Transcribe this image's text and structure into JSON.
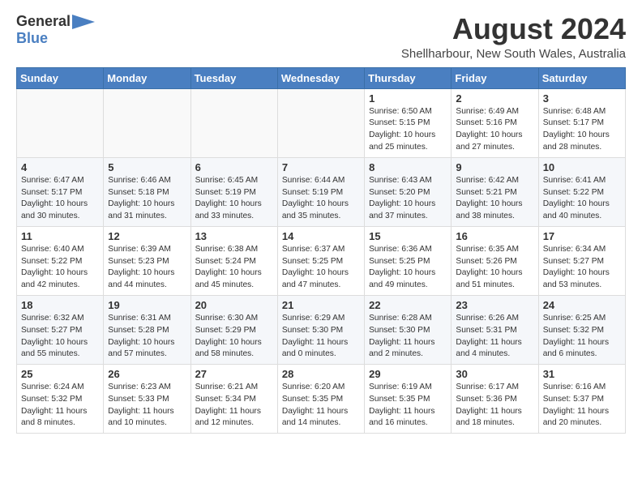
{
  "logo": {
    "general": "General",
    "blue": "Blue"
  },
  "title": {
    "month_year": "August 2024",
    "location": "Shellharbour, New South Wales, Australia"
  },
  "weekdays": [
    "Sunday",
    "Monday",
    "Tuesday",
    "Wednesday",
    "Thursday",
    "Friday",
    "Saturday"
  ],
  "weeks": [
    [
      {
        "day": "",
        "detail": ""
      },
      {
        "day": "",
        "detail": ""
      },
      {
        "day": "",
        "detail": ""
      },
      {
        "day": "",
        "detail": ""
      },
      {
        "day": "1",
        "detail": "Sunrise: 6:50 AM\nSunset: 5:15 PM\nDaylight: 10 hours\nand 25 minutes."
      },
      {
        "day": "2",
        "detail": "Sunrise: 6:49 AM\nSunset: 5:16 PM\nDaylight: 10 hours\nand 27 minutes."
      },
      {
        "day": "3",
        "detail": "Sunrise: 6:48 AM\nSunset: 5:17 PM\nDaylight: 10 hours\nand 28 minutes."
      }
    ],
    [
      {
        "day": "4",
        "detail": "Sunrise: 6:47 AM\nSunset: 5:17 PM\nDaylight: 10 hours\nand 30 minutes."
      },
      {
        "day": "5",
        "detail": "Sunrise: 6:46 AM\nSunset: 5:18 PM\nDaylight: 10 hours\nand 31 minutes."
      },
      {
        "day": "6",
        "detail": "Sunrise: 6:45 AM\nSunset: 5:19 PM\nDaylight: 10 hours\nand 33 minutes."
      },
      {
        "day": "7",
        "detail": "Sunrise: 6:44 AM\nSunset: 5:19 PM\nDaylight: 10 hours\nand 35 minutes."
      },
      {
        "day": "8",
        "detail": "Sunrise: 6:43 AM\nSunset: 5:20 PM\nDaylight: 10 hours\nand 37 minutes."
      },
      {
        "day": "9",
        "detail": "Sunrise: 6:42 AM\nSunset: 5:21 PM\nDaylight: 10 hours\nand 38 minutes."
      },
      {
        "day": "10",
        "detail": "Sunrise: 6:41 AM\nSunset: 5:22 PM\nDaylight: 10 hours\nand 40 minutes."
      }
    ],
    [
      {
        "day": "11",
        "detail": "Sunrise: 6:40 AM\nSunset: 5:22 PM\nDaylight: 10 hours\nand 42 minutes."
      },
      {
        "day": "12",
        "detail": "Sunrise: 6:39 AM\nSunset: 5:23 PM\nDaylight: 10 hours\nand 44 minutes."
      },
      {
        "day": "13",
        "detail": "Sunrise: 6:38 AM\nSunset: 5:24 PM\nDaylight: 10 hours\nand 45 minutes."
      },
      {
        "day": "14",
        "detail": "Sunrise: 6:37 AM\nSunset: 5:25 PM\nDaylight: 10 hours\nand 47 minutes."
      },
      {
        "day": "15",
        "detail": "Sunrise: 6:36 AM\nSunset: 5:25 PM\nDaylight: 10 hours\nand 49 minutes."
      },
      {
        "day": "16",
        "detail": "Sunrise: 6:35 AM\nSunset: 5:26 PM\nDaylight: 10 hours\nand 51 minutes."
      },
      {
        "day": "17",
        "detail": "Sunrise: 6:34 AM\nSunset: 5:27 PM\nDaylight: 10 hours\nand 53 minutes."
      }
    ],
    [
      {
        "day": "18",
        "detail": "Sunrise: 6:32 AM\nSunset: 5:27 PM\nDaylight: 10 hours\nand 55 minutes."
      },
      {
        "day": "19",
        "detail": "Sunrise: 6:31 AM\nSunset: 5:28 PM\nDaylight: 10 hours\nand 57 minutes."
      },
      {
        "day": "20",
        "detail": "Sunrise: 6:30 AM\nSunset: 5:29 PM\nDaylight: 10 hours\nand 58 minutes."
      },
      {
        "day": "21",
        "detail": "Sunrise: 6:29 AM\nSunset: 5:30 PM\nDaylight: 11 hours\nand 0 minutes."
      },
      {
        "day": "22",
        "detail": "Sunrise: 6:28 AM\nSunset: 5:30 PM\nDaylight: 11 hours\nand 2 minutes."
      },
      {
        "day": "23",
        "detail": "Sunrise: 6:26 AM\nSunset: 5:31 PM\nDaylight: 11 hours\nand 4 minutes."
      },
      {
        "day": "24",
        "detail": "Sunrise: 6:25 AM\nSunset: 5:32 PM\nDaylight: 11 hours\nand 6 minutes."
      }
    ],
    [
      {
        "day": "25",
        "detail": "Sunrise: 6:24 AM\nSunset: 5:32 PM\nDaylight: 11 hours\nand 8 minutes."
      },
      {
        "day": "26",
        "detail": "Sunrise: 6:23 AM\nSunset: 5:33 PM\nDaylight: 11 hours\nand 10 minutes."
      },
      {
        "day": "27",
        "detail": "Sunrise: 6:21 AM\nSunset: 5:34 PM\nDaylight: 11 hours\nand 12 minutes."
      },
      {
        "day": "28",
        "detail": "Sunrise: 6:20 AM\nSunset: 5:35 PM\nDaylight: 11 hours\nand 14 minutes."
      },
      {
        "day": "29",
        "detail": "Sunrise: 6:19 AM\nSunset: 5:35 PM\nDaylight: 11 hours\nand 16 minutes."
      },
      {
        "day": "30",
        "detail": "Sunrise: 6:17 AM\nSunset: 5:36 PM\nDaylight: 11 hours\nand 18 minutes."
      },
      {
        "day": "31",
        "detail": "Sunrise: 6:16 AM\nSunset: 5:37 PM\nDaylight: 11 hours\nand 20 minutes."
      }
    ]
  ]
}
